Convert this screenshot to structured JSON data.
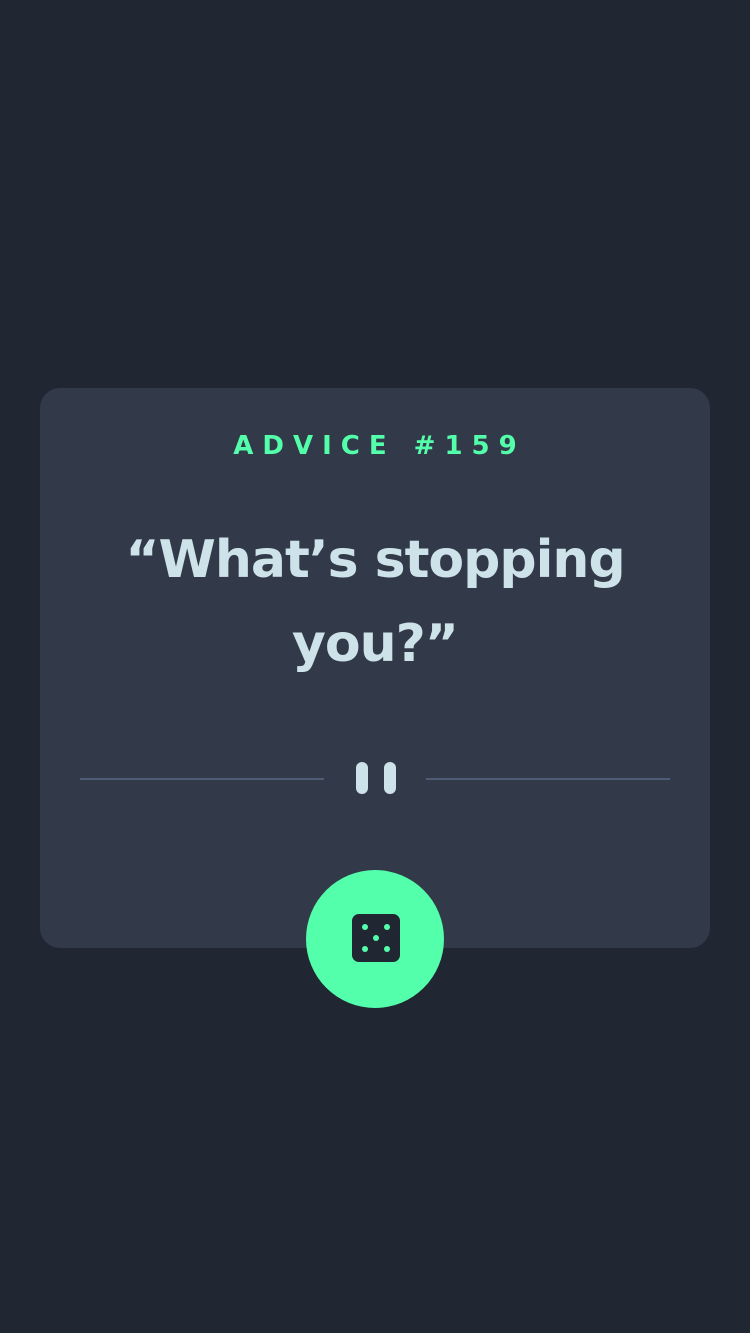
{
  "advice": {
    "id_label": "ADVICE #159",
    "quote": "“What’s stopping you?”"
  },
  "divider": {
    "icon": "pause-icon"
  },
  "button": {
    "icon": "dice-icon"
  },
  "colors": {
    "background": "#202632",
    "card": "#323a49",
    "accent": "#53ffaa",
    "text": "#cee3e9",
    "divider": "#4f5d74"
  }
}
